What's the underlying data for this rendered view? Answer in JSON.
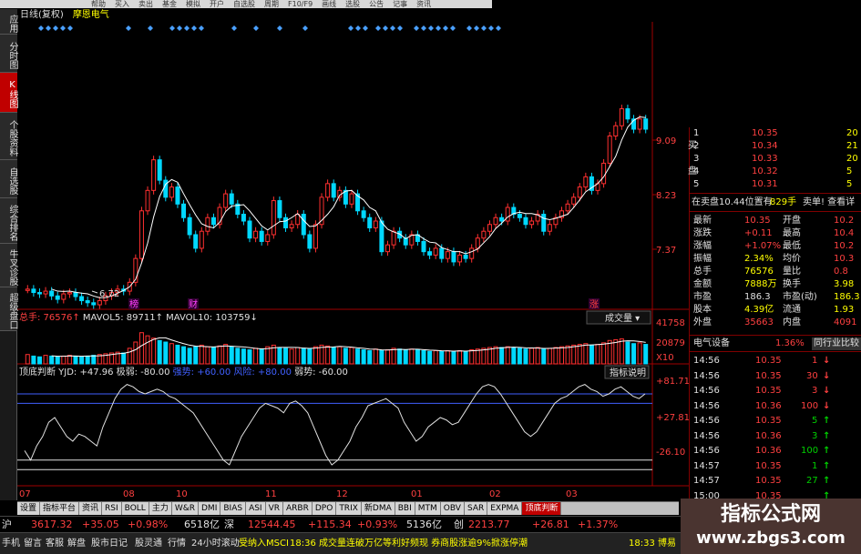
{
  "menu": [
    "帮助",
    "买入",
    "卖出",
    "基金",
    "模拟",
    "开户",
    "自选股",
    "周期",
    "F10/F9",
    "画线",
    "选股",
    "公告",
    "记事",
    "资讯"
  ],
  "header": {
    "period_label": "日线(复权)",
    "stock_name": "摩恩电气"
  },
  "left_tabs": [
    {
      "label": "应用",
      "active": false
    },
    {
      "label": "分时图",
      "active": false
    },
    {
      "label": "K线图",
      "active": true
    },
    {
      "label": "个股资料",
      "active": false
    },
    {
      "label": "自选股",
      "active": false
    },
    {
      "label": "综合排名",
      "active": false
    },
    {
      "label": "牛叉诊股",
      "active": false
    },
    {
      "label": "超级盘口",
      "active": false
    }
  ],
  "price_axis": [
    "9.09",
    "8.23",
    "7.37"
  ],
  "low_label": "6.72",
  "event_markers": [
    {
      "label": "榜",
      "color": "#ff40ff"
    },
    {
      "label": "财",
      "color": "#ff40ff"
    },
    {
      "label": "涨",
      "color": "#ff4040"
    }
  ],
  "volume": {
    "total_label": "总手: 76576",
    "ma5_label": "MAVOL5: 89711",
    "ma10_label": "MAVOL10: 103759",
    "dropdown": "成交量",
    "axis": [
      "41758",
      "20879",
      "X10"
    ]
  },
  "indicator": {
    "name": "顶底判断 YJD: +47.96",
    "levels": [
      {
        "label": "极弱: -80.00",
        "color": "#e0e0e0"
      },
      {
        "label": "强势: +60.00",
        "color": "#4060ff"
      },
      {
        "label": "风险: +80.00",
        "color": "#4060ff"
      },
      {
        "label": "弱势: -60.00",
        "color": "#e0e0e0"
      }
    ],
    "help_button": "指标说明",
    "axis": [
      "+81.71",
      "+27.81",
      "-26.10"
    ]
  },
  "x_axis": [
    "07",
    "08",
    "10",
    "11",
    "12",
    "01",
    "02",
    "03"
  ],
  "order_book": {
    "side_label": "买盘",
    "side_chars": [
      "买",
      "盘"
    ],
    "rows": [
      {
        "level": "1",
        "price": "10.35",
        "qty": "20"
      },
      {
        "level": "2",
        "price": "10.34",
        "qty": "21"
      },
      {
        "level": "3",
        "price": "10.33",
        "qty": "20"
      },
      {
        "level": "4",
        "price": "10.32",
        "qty": "5"
      },
      {
        "level": "5",
        "price": "10.31",
        "qty": "5"
      }
    ]
  },
  "sell_info": {
    "text": "在卖盘10.44位置有",
    "qty": "829手",
    "extra": "卖单! 查看详"
  },
  "quote": [
    {
      "l1": "最新",
      "v1": "10.35",
      "c1": "red",
      "l2": "开盘",
      "v2": "10.2"
    },
    {
      "l1": "涨跌",
      "v1": "+0.11",
      "c1": "red",
      "l2": "最高",
      "v2": "10.4"
    },
    {
      "l1": "涨幅",
      "v1": "+1.07%",
      "c1": "red",
      "l2": "最低",
      "v2": "10.2"
    },
    {
      "l1": "振幅",
      "v1": "2.34%",
      "c1": "yellow",
      "l2": "均价",
      "v2": "10.3"
    },
    {
      "l1": "总手",
      "v1": "76576",
      "c1": "yellow",
      "l2": "量比",
      "v2": "0.8"
    },
    {
      "l1": "金额",
      "v1": "7888万",
      "c1": "yellow",
      "l2": "换手",
      "v2": "3.98"
    },
    {
      "l1": "市盈",
      "v1": "186.3",
      "c1": "white",
      "l2": "市盈(动)",
      "v2": "186.3"
    },
    {
      "l1": "股本",
      "v1": "4.39亿",
      "c1": "yellow",
      "l2": "流通",
      "v2": "1.93"
    },
    {
      "l1": "外盘",
      "v1": "35663",
      "c1": "red",
      "l2": "内盘",
      "v2": "4091"
    }
  ],
  "sector": {
    "name": "电气设备",
    "change": "1.36%",
    "link": "同行业比较"
  },
  "ticks": [
    {
      "time": "14:56",
      "price": "10.35",
      "vol": "1",
      "dir": "down"
    },
    {
      "time": "14:56",
      "price": "10.35",
      "vol": "30",
      "dir": "down"
    },
    {
      "time": "14:56",
      "price": "10.35",
      "vol": "3",
      "dir": "down"
    },
    {
      "time": "14:56",
      "price": "10.36",
      "vol": "100",
      "dir": "down"
    },
    {
      "time": "14:56",
      "price": "10.35",
      "vol": "5",
      "dir": "up"
    },
    {
      "time": "14:56",
      "price": "10.36",
      "vol": "3",
      "dir": "up"
    },
    {
      "time": "14:56",
      "price": "10.36",
      "vol": "100",
      "dir": "up"
    },
    {
      "time": "14:57",
      "price": "10.35",
      "vol": "1",
      "dir": "up"
    },
    {
      "time": "14:57",
      "price": "10.35",
      "vol": "27",
      "dir": "up"
    },
    {
      "time": "15:00",
      "price": "10.35",
      "vol": "",
      "dir": "up"
    }
  ],
  "bottom_tabs": [
    "设置",
    "指标平台",
    "资讯",
    "RSI",
    "BOLL",
    "主力",
    "W&R",
    "DMI",
    "BIAS",
    "ASI",
    "VR",
    "ARBR",
    "DPO",
    "TRIX",
    "新DMA",
    "BBI",
    "MTM",
    "OBV",
    "SAR",
    "EXPMA",
    "顶底判断"
  ],
  "active_bottom_tab": "顶底判断",
  "status_index": [
    {
      "text": "沪",
      "color": "#e0e0e0"
    },
    {
      "text": "3617.32",
      "color": "#ff4040"
    },
    {
      "text": "+35.05",
      "color": "#ff4040"
    },
    {
      "text": "+0.98%",
      "color": "#ff4040"
    },
    {
      "text": "6518亿",
      "color": "#e0e0e0"
    },
    {
      "text": "深",
      "color": "#e0e0e0"
    },
    {
      "text": "12544.45",
      "color": "#ff4040"
    },
    {
      "text": "+115.34",
      "color": "#ff4040"
    },
    {
      "text": "+0.93%",
      "color": "#ff4040"
    },
    {
      "text": "5136亿",
      "color": "#e0e0e0"
    },
    {
      "text": "创",
      "color": "#e0e0e0"
    },
    {
      "text": "2213.77",
      "color": "#ff4040"
    },
    {
      "text": "+26.81",
      "color": "#ff4040"
    },
    {
      "text": "+1.37%",
      "color": "#ff4040"
    }
  ],
  "status_bottom": [
    {
      "text": "手机",
      "color": "#e0e0e0"
    },
    {
      "text": "留言",
      "color": "#e0e0e0"
    },
    {
      "text": "客服",
      "color": "#e0e0e0"
    },
    {
      "text": "解盘",
      "color": "#e0e0e0"
    },
    {
      "text": "股市日记",
      "color": "#e0e0e0"
    },
    {
      "text": "股灵通",
      "color": "#e0e0e0"
    },
    {
      "text": "行情",
      "color": "#e0e0e0"
    },
    {
      "text": "24小时滚动",
      "color": "#e0e0e0"
    },
    {
      "text": "受纳入MSCI",
      "color": "#ffff00"
    },
    {
      "text": "18:36 成交量连破万亿等利好频现 券商股涨逾9%掀涨停潮",
      "color": "#ffff00"
    },
    {
      "text": "18:33 博易",
      "color": "#ffff00"
    }
  ],
  "watermark": {
    "title": "指标公式网",
    "url": "www.zbgs3.com"
  },
  "colors": {
    "up": "#ff3030",
    "down": "#00d8ff",
    "ma": "#ffffff",
    "grid": "#800000",
    "frame": "#a00000"
  },
  "chart_data": {
    "type": "candlestick",
    "title": "摩恩电气",
    "x_ticks": [
      "07",
      "08",
      "10",
      "11",
      "12",
      "01",
      "02",
      "03"
    ],
    "y_ticks": [
      7.37,
      8.23,
      9.09
    ],
    "y_range": [
      6.6,
      9.3
    ],
    "close": [
      6.95,
      6.9,
      6.88,
      6.92,
      6.85,
      6.8,
      6.88,
      6.9,
      6.84,
      6.78,
      6.75,
      6.72,
      6.78,
      6.85,
      6.9,
      6.95,
      6.92,
      7.05,
      7.4,
      8.1,
      8.4,
      8.85,
      8.55,
      8.3,
      8.45,
      8.2,
      8.0,
      7.75,
      7.55,
      7.8,
      8.0,
      7.9,
      8.15,
      8.35,
      8.2,
      8.05,
      7.95,
      7.7,
      7.8,
      7.65,
      7.75,
      8.25,
      8.0,
      7.85,
      7.9,
      8.05,
      7.75,
      7.55,
      7.9,
      8.3,
      8.5,
      8.3,
      8.4,
      8.2,
      8.35,
      8.1,
      8.0,
      7.85,
      7.95,
      7.5,
      7.6,
      7.8,
      7.7,
      7.6,
      7.75,
      7.65,
      7.5,
      7.45,
      7.55,
      7.4,
      7.5,
      7.35,
      7.45,
      7.4,
      7.55,
      7.7,
      7.8,
      7.9,
      8.0,
      7.95,
      8.15,
      8.05,
      8.0,
      7.9,
      7.95,
      8.05,
      7.8,
      7.9,
      8.0,
      8.1,
      8.2,
      8.3,
      8.45,
      8.6,
      8.4,
      8.5,
      8.8,
      9.2,
      9.35,
      9.6,
      9.45,
      9.3,
      9.45,
      9.3
    ],
    "volume": [
      12,
      10,
      9,
      11,
      10,
      9,
      10,
      11,
      10,
      9,
      10,
      11,
      12,
      13,
      14,
      15,
      14,
      20,
      28,
      40,
      36,
      33,
      30,
      28,
      26,
      24,
      22,
      20,
      22,
      24,
      22,
      21,
      23,
      25,
      22,
      20,
      19,
      18,
      20,
      19,
      22,
      24,
      21,
      20,
      19,
      21,
      20,
      19,
      22,
      24,
      23,
      21,
      22,
      20,
      21,
      19,
      18,
      17,
      19,
      17,
      18,
      20,
      19,
      18,
      19,
      18,
      17,
      16,
      17,
      16,
      17,
      16,
      17,
      16,
      18,
      19,
      20,
      21,
      22,
      21,
      22,
      21,
      20,
      19,
      20,
      21,
      19,
      20,
      21,
      22,
      23,
      24,
      25,
      26,
      24,
      25,
      27,
      30,
      31,
      32,
      28,
      26,
      27,
      25
    ],
    "indicator_series_name": "YJD",
    "indicator_ticks": [
      -26.1,
      27.81,
      81.71
    ],
    "indicator": [
      -40,
      -60,
      -30,
      -10,
      20,
      30,
      10,
      -10,
      -20,
      -5,
      -10,
      -20,
      -30,
      10,
      40,
      70,
      90,
      100,
      95,
      85,
      80,
      85,
      90,
      85,
      75,
      70,
      60,
      50,
      40,
      20,
      0,
      -20,
      -40,
      -60,
      -70,
      -40,
      -10,
      10,
      30,
      50,
      60,
      55,
      50,
      40,
      60,
      65,
      55,
      40,
      10,
      -20,
      -50,
      -70,
      -60,
      -40,
      -20,
      10,
      30,
      55,
      60,
      65,
      70,
      60,
      50,
      20,
      0,
      -20,
      -10,
      10,
      20,
      30,
      25,
      15,
      20,
      40,
      60,
      80,
      95,
      100,
      95,
      80,
      60,
      40,
      20,
      0,
      -10,
      0,
      20,
      40,
      60,
      70,
      75,
      85,
      95,
      100,
      90,
      85,
      75,
      80,
      90,
      95,
      85,
      75,
      70,
      80
    ],
    "indicator_levels": [
      -80,
      -60,
      60,
      80
    ]
  }
}
